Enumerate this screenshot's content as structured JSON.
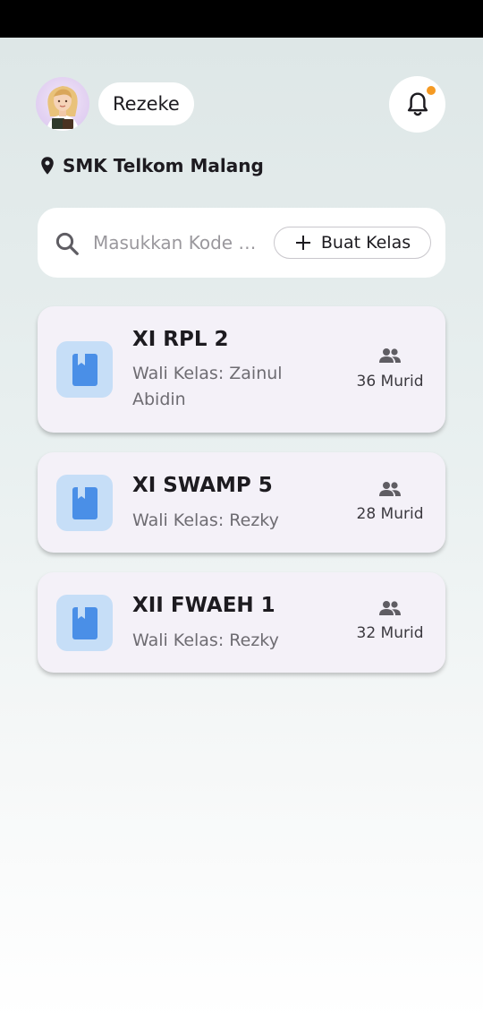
{
  "header": {
    "user_name": "Rezeke",
    "school_name": "SMK Telkom Malang",
    "notification_dot_color": "#f59a23"
  },
  "search": {
    "placeholder": "Masukkan Kode Kelas",
    "value": "",
    "create_label": "Buat Kelas"
  },
  "classes": [
    {
      "name": "XI RPL 2",
      "teacher": "Wali Kelas: Zainul Abidin",
      "students": "36 Murid"
    },
    {
      "name": "XI SWAMP 5",
      "teacher": "Wali Kelas: Rezky",
      "students": "28 Murid"
    },
    {
      "name": "XII FWAEH 1",
      "teacher": "Wali Kelas: Rezky",
      "students": "32 Murid"
    }
  ],
  "colors": {
    "accent_blue": "#4a8fe7",
    "icon_tile": "#c6def7",
    "card_bg": "#f4f1f8"
  }
}
